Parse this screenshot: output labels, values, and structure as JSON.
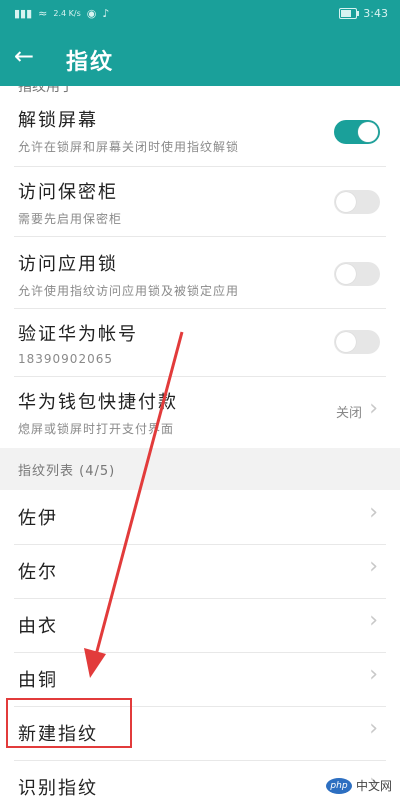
{
  "status_bar": {
    "left_icons": [
      "signal-icon",
      "wifi-icon",
      "data-icon",
      "vpn-icon",
      "tiktok-icon"
    ],
    "speed": "2.4\nK/s",
    "time": "3:43",
    "battery_level": 0.7
  },
  "app_bar": {
    "title": "指纹"
  },
  "partial_text": "指纹用于",
  "settings": [
    {
      "title": "解锁屏幕",
      "subtitle": "允许在锁屏和屏幕关闭时使用指纹解锁",
      "toggle": true
    },
    {
      "title": "访问保密柜",
      "subtitle": "需要先启用保密柜",
      "toggle": false
    },
    {
      "title": "访问应用锁",
      "subtitle": "允许使用指纹访问应用锁及被锁定应用",
      "toggle": false
    },
    {
      "title": "验证华为帐号",
      "subtitle": "18390902065",
      "toggle": false
    },
    {
      "title": "华为钱包快捷付款",
      "subtitle": "熄屏或锁屏时打开支付界面",
      "value": "关闭"
    }
  ],
  "fingerprint_list": {
    "header": "指纹列表 (4/5)",
    "items": [
      "佐伊",
      "佐尔",
      "由衣",
      "由铜",
      "新建指纹",
      "识别指纹"
    ]
  },
  "annotation_color": "#e23b3b",
  "watermark": {
    "logo": "php",
    "text": "中文网"
  }
}
